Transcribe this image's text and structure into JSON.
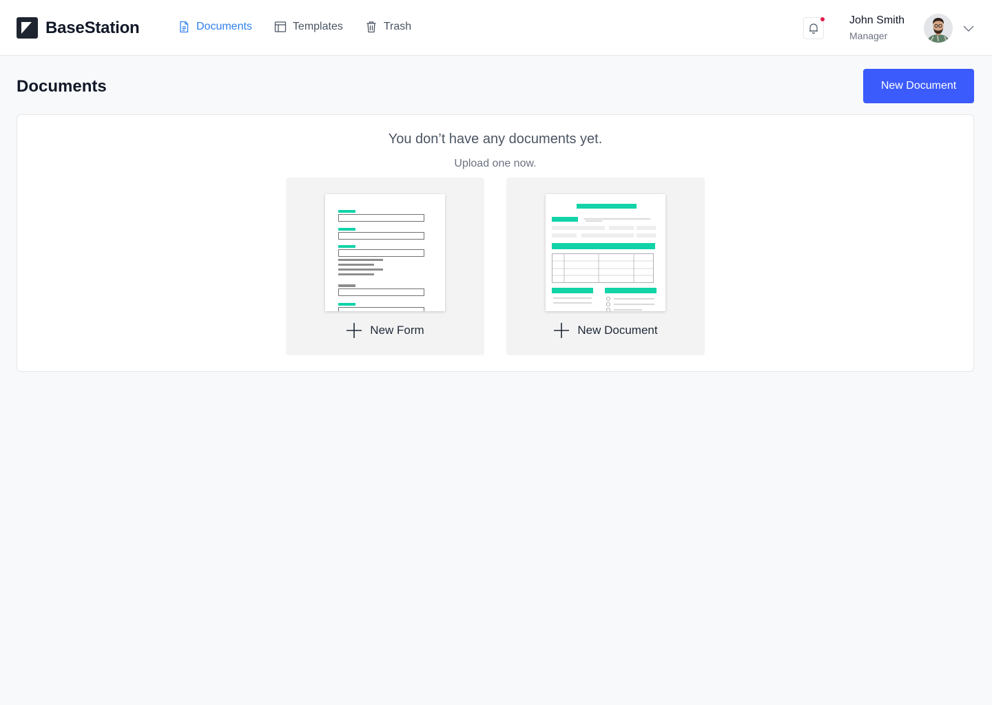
{
  "app": {
    "name": "BaseStation"
  },
  "nav": {
    "items": [
      {
        "label": "Documents",
        "icon": "document-icon",
        "active": true
      },
      {
        "label": "Templates",
        "icon": "table-icon",
        "active": false
      },
      {
        "label": "Trash",
        "icon": "trash-icon",
        "active": false
      }
    ]
  },
  "user": {
    "name": "John Smith",
    "role": "Manager"
  },
  "notifications": {
    "icon": "bell-icon",
    "has_unread": true
  },
  "page": {
    "title": "Documents",
    "new_document_label": "New Document"
  },
  "empty_state": {
    "title": "You don’t have any documents yet.",
    "subtitle": "Upload one now."
  },
  "cards": [
    {
      "label": "New Form",
      "icon": "plus-icon"
    },
    {
      "label": "New Document",
      "icon": "plus-icon"
    }
  ],
  "colors": {
    "primary": "#3b5bfd",
    "nav_active": "#2f80ed",
    "accent_teal": "#12d3a8",
    "notification_dot": "#e11d48"
  }
}
